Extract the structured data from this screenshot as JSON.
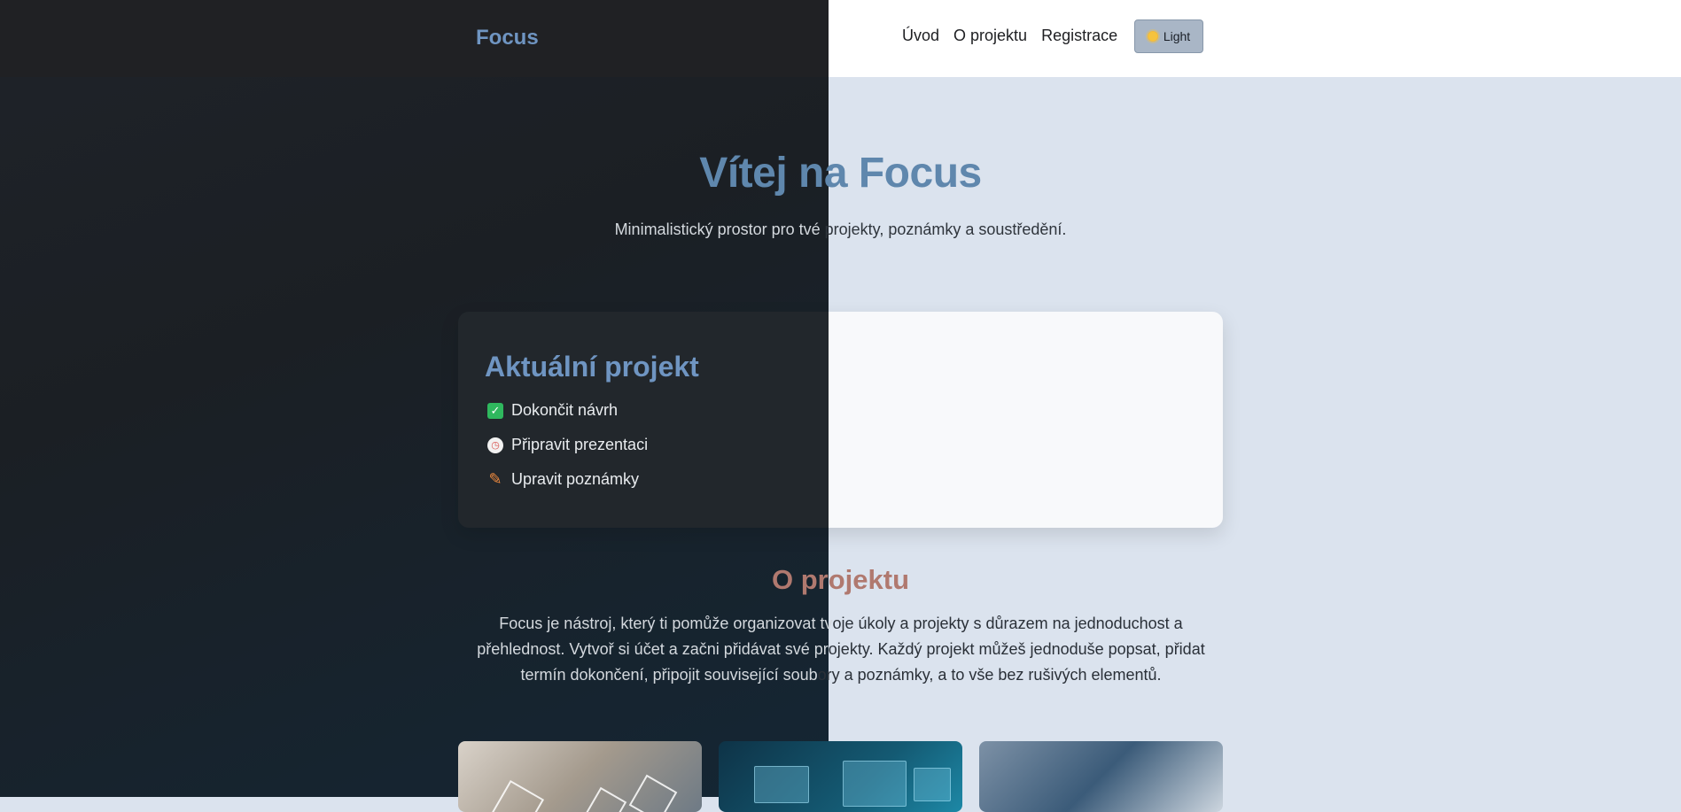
{
  "header": {
    "brand": "Focus",
    "nav": [
      "Úvod",
      "O projektu",
      "Registrace"
    ],
    "theme_toggle": {
      "label": "Light",
      "icon": "sun-icon"
    }
  },
  "hero": {
    "title": "Vítej na Focus",
    "subtitle_a": "Minimalistický prostor pro tvé ",
    "subtitle_b": "projekty, poznámky a soustředění."
  },
  "project": {
    "title": "Aktuální projekt",
    "tasks": [
      {
        "icon": "check-icon",
        "label": "Dokončit návrh"
      },
      {
        "icon": "clock-icon",
        "label": "Připravit prezentaci"
      },
      {
        "icon": "pencil-icon",
        "label": "Upravit poznámky"
      }
    ]
  },
  "about": {
    "title": "O projektu",
    "line1_a": "Focus je nástroj, který ti pomůže organizovat tv",
    "line1_b": "oje úkoly a projekty s důrazem na jednoduchost a",
    "line2_a": "přehlednost. Vytvoř si účet a začni přidávat své pr",
    "line2_b": "ojekty. Každý projekt můžeš jednoduše popsat, přidat",
    "line3_a": "termín dokončení, připojit související soub",
    "line3_b": "ory a poznámky, a to vše bez rušivých elementů."
  },
  "colors": {
    "accent": "#6f95c2",
    "about_title": "#b0796f",
    "dark_bg": "#1f2329",
    "light_bg": "#dbe3ee"
  }
}
